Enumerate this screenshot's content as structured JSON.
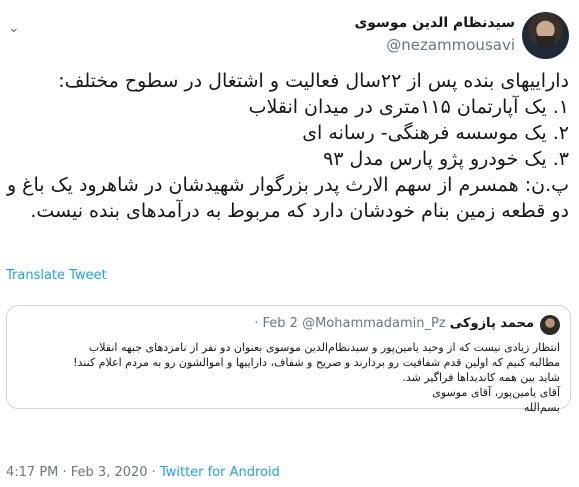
{
  "author": {
    "name": "سیدنظام الدین موسوی",
    "handle": "@nezammousavi"
  },
  "tweet": {
    "lines": [
      "داراییهای بنده پس از ۲۲سال فعالیت و اشتغال در سطوح مختلف:",
      "۱. یک آپارتمان ۱۱۵متری در میدان انقلاب",
      "۲. یک موسسه فرهنگی- رسانه ای",
      "۳. یک خودرو پژو پارس مدل ۹۳",
      "پ.ن: همسرم از سهم الارث پدر بزرگوار شهیدشان در شاهرود یک باغ و",
      "دو قطعه زمین بنام خودشان دارد که مربوط به درآمدهای بنده نیست."
    ]
  },
  "translate_label": "Translate Tweet",
  "quote": {
    "name": "محمد پازوکی",
    "handle": "@Mohammadamin_Pz",
    "date": "· Feb 2",
    "lines": [
      "انتظار زیادی نیست که از وحید یامین‌پور و سیدنظام‌الدین موسوی بعنوان دو نفر از نامزدهای جبهه انقلاب",
      "مطالبه کنیم که اولین قدم شفافیت رو بردارند و صریح و شفاف، داراییها و اموالشون رو به مردم اعلام کنند!",
      "شاید بین همه کاندیداها فراگیر شد.",
      "آقای یامین‌پور، آقای موسوی",
      "بسم‌الله"
    ]
  },
  "footer": {
    "time": "4:17 PM · Feb 3, 2020 · ",
    "source": "Twitter for Android"
  }
}
